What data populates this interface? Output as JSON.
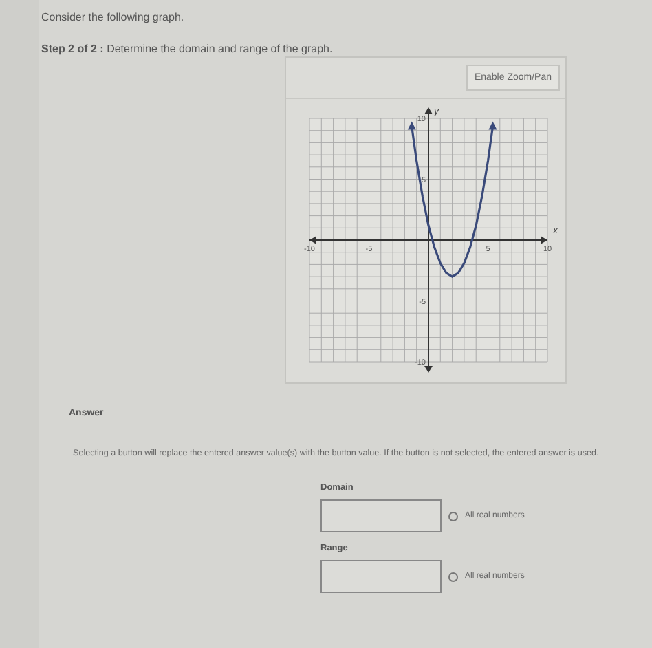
{
  "intro": "Consider the following graph.",
  "step": {
    "label": "Step 2 of 2 :",
    "text": "Determine the domain and range of the graph."
  },
  "graph": {
    "zoom_button": "Enable Zoom/Pan",
    "chart_data": {
      "type": "line",
      "xlabel": "x",
      "ylabel": "y",
      "xlim": [
        -10,
        10
      ],
      "ylim": [
        -10,
        10
      ],
      "xticks": [
        -10,
        -5,
        5,
        10
      ],
      "yticks": [
        -10,
        -5,
        5,
        10
      ],
      "grid": true,
      "x": [
        -1.4,
        -1,
        -0.5,
        0,
        0.5,
        1,
        1.5,
        2,
        2.5,
        3,
        3.5,
        4,
        4.5,
        5,
        5.4
      ],
      "series": [
        {
          "color": "#3a4a7a",
          "values": [
            9.3,
            6.5,
            3.6,
            1.2,
            -0.6,
            -1.9,
            -2.7,
            -3,
            -2.7,
            -1.9,
            -0.6,
            1.2,
            3.6,
            6.5,
            9.3
          ]
        }
      ]
    }
  },
  "answer": {
    "heading": "Answer",
    "instruction": "Selecting a button will replace the entered answer value(s) with the button value. If the button is not selected, the entered answer is used.",
    "fields": [
      {
        "label": "Domain",
        "option": "All real numbers",
        "selected": false
      },
      {
        "label": "Range",
        "option": "All real numbers",
        "selected": false
      }
    ]
  }
}
